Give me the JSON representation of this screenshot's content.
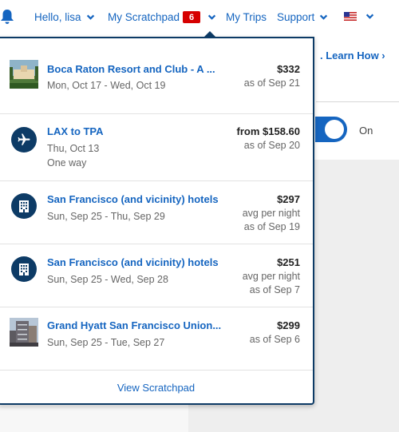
{
  "nav": {
    "greeting": "Hello, lisa",
    "scratchpad_label": "My Scratchpad",
    "scratchpad_count": "6",
    "trips_label": "My Trips",
    "support_label": "Support"
  },
  "background": {
    "learn_link": ". Learn How ›",
    "toggle_label": "On"
  },
  "scratchpad": {
    "items": [
      {
        "kind": "hotel-photo",
        "title": "Boca Raton Resort and Club - A ...",
        "dates": "Mon, Oct 17 - Wed, Oct 19",
        "price": "$332",
        "note1": "as of Sep 21"
      },
      {
        "kind": "flight",
        "icon": "airplane-icon",
        "title": "LAX to TPA",
        "dates": "Thu, Oct 13",
        "extra": "One way",
        "price": "from $158.60",
        "note1": "as of Sep 20"
      },
      {
        "kind": "hotel-search",
        "icon": "building-icon",
        "title": "San Francisco (and vicinity) hotels",
        "dates": "Sun, Sep 25 - Thu, Sep 29",
        "price": "$297",
        "note1": "avg per night",
        "note2": "as of Sep 19"
      },
      {
        "kind": "hotel-search",
        "icon": "building-icon",
        "title": "San Francisco (and vicinity) hotels",
        "dates": "Sun, Sep 25 - Wed, Sep 28",
        "price": "$251",
        "note1": "avg per night",
        "note2": "as of Sep 7"
      },
      {
        "kind": "hotel-photo",
        "title": "Grand Hyatt San Francisco Union...",
        "dates": "Sun, Sep 25 - Tue, Sep 27",
        "price": "$299",
        "note1": "as of Sep 6"
      }
    ],
    "view_all": "View Scratchpad"
  },
  "colors": {
    "link_blue": "#1565c0",
    "navy": "#0d3b66",
    "badge_red": "#d60000"
  }
}
